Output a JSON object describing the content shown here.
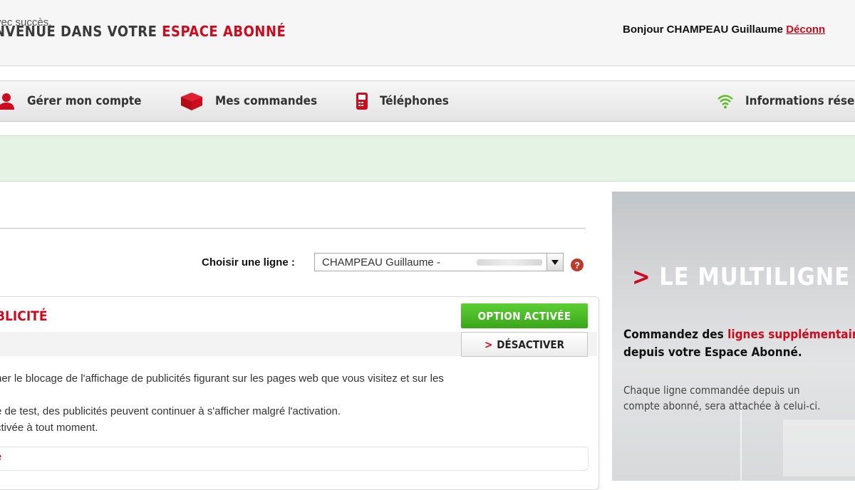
{
  "header": {
    "welcome_prefix": "NVENUE DANS VOTRE ",
    "welcome_highlight": "ESPACE ABONNÉ",
    "greeting": "Bonjour CHAMPEAU Guillaume ",
    "logout": "Déconn"
  },
  "nav": {
    "items": [
      {
        "label": "Gérer mon compte",
        "icon": "user-icon"
      },
      {
        "label": "Mes commandes",
        "icon": "box-icon"
      },
      {
        "label": "Téléphones",
        "icon": "phone-icon"
      },
      {
        "label": "Informations résea",
        "icon": "wifi-icon"
      }
    ]
  },
  "alert": {
    "text": "vec succès."
  },
  "line_selector": {
    "label": "Choisir une ligne :",
    "selected": "CHAMPEAU Guillaume - "
  },
  "option": {
    "title": "BLICITÉ",
    "status": "OPTION ACTIVÉE",
    "deactivate": "DÉSACTIVER",
    "deactivate_prefix": ">",
    "lines": [
      "ner le blocage de l'affichage de publicités figurant sur les pages web que vous visitez et sur les",
      "e de test, des publicités peuvent continuer à s'afficher malgré l'activation.",
      "ctivée à tout moment."
    ],
    "link": "e"
  },
  "promo": {
    "title_prefix": ">",
    "title": "LE MULTILIGNE",
    "headline_1": "Commandez des ",
    "headline_highlight": "lignes supplémentair",
    "headline_2": "depuis votre Espace Abonné.",
    "body_1": "Chaque ligne commandée depuis un",
    "body_2": "compte abonné, sera attachée à celui-ci."
  },
  "colors": {
    "brand_red": "#cc0b1f",
    "active_green": "#46b321"
  }
}
